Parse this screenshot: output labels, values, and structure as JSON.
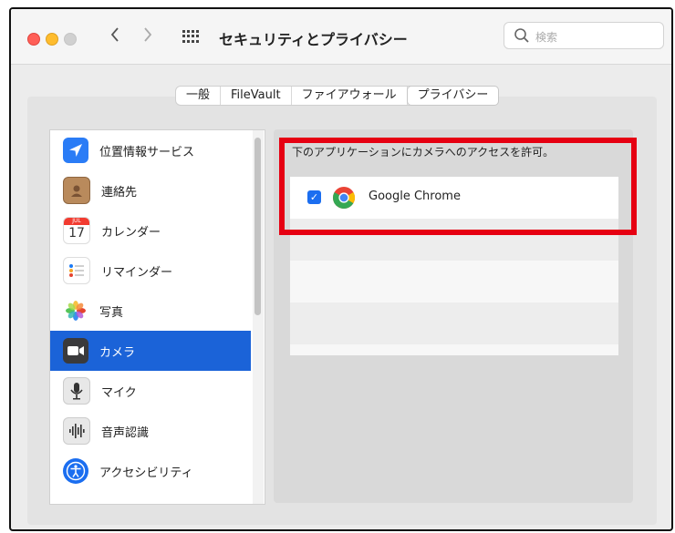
{
  "window": {
    "title": "セキュリティとプライバシー"
  },
  "search": {
    "placeholder": "検索"
  },
  "tabs": [
    {
      "label": "一般"
    },
    {
      "label": "FileVault"
    },
    {
      "label": "ファイアウォール"
    },
    {
      "label": "プライバシー"
    }
  ],
  "sidebar": {
    "items": [
      {
        "label": "位置情報サービス",
        "icon": "location-arrow-icon"
      },
      {
        "label": "連絡先",
        "icon": "contacts-icon"
      },
      {
        "label": "カレンダー",
        "icon": "calendar-icon",
        "calendar_month": "JUL",
        "calendar_day": "17"
      },
      {
        "label": "リマインダー",
        "icon": "reminders-icon"
      },
      {
        "label": "写真",
        "icon": "photos-icon"
      },
      {
        "label": "カメラ",
        "icon": "camera-icon",
        "selected": true
      },
      {
        "label": "マイク",
        "icon": "microphone-icon"
      },
      {
        "label": "音声認識",
        "icon": "speech-recognition-icon"
      },
      {
        "label": "アクセシビリティ",
        "icon": "accessibility-icon"
      }
    ]
  },
  "right_panel": {
    "header": "下のアプリケーションにカメラへのアクセスを許可。",
    "apps": [
      {
        "name": "Google Chrome",
        "checked": true,
        "icon": "chrome-icon"
      }
    ]
  },
  "colors": {
    "selection": "#1b63d8",
    "highlight_box": "#e60012",
    "checkbox": "#1b6ef0"
  }
}
